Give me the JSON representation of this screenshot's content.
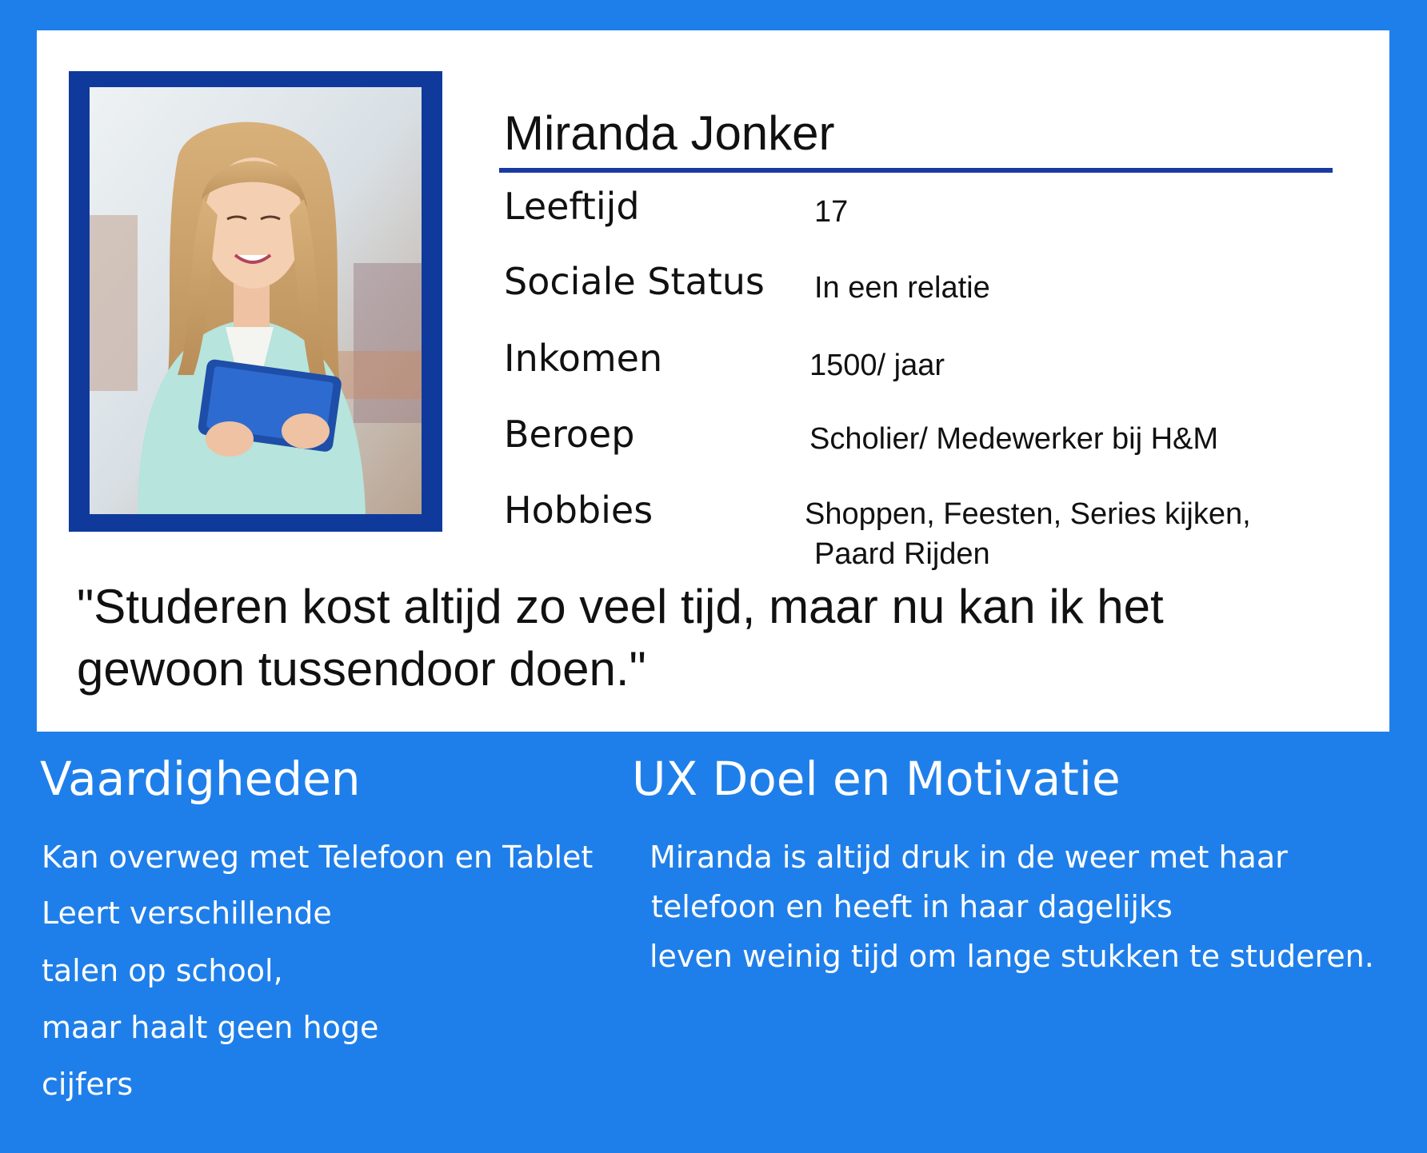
{
  "persona": {
    "name": "Miranda Jonker",
    "fields": [
      {
        "label": "Leeftijd",
        "value": "17"
      },
      {
        "label": "Sociale Status",
        "value": "In een relatie"
      },
      {
        "label": "Inkomen",
        "value": "1500/ jaar"
      },
      {
        "label": "Beroep",
        "value": "Scholier/ Medewerker bij H&M"
      },
      {
        "label": "Hobbies",
        "value": "Shoppen, Feesten, Series kijken,",
        "value2": "Paard Rijden"
      }
    ],
    "quote_line1": "\"Studeren kost altijd zo veel tijd, maar nu kan ik het",
    "quote_line2": "gewoon tussendoor doen.\""
  },
  "skills": {
    "title": "Vaardigheden",
    "lines": [
      "Kan overweg met Telefoon en Tablet",
      "Leert verschillende",
      "talen op school,",
      "maar haalt geen hoge",
      "cijfers"
    ]
  },
  "ux_goal": {
    "title": "UX Doel en Motivatie",
    "lines": [
      "Miranda is altijd druk in de weer met haar",
      "telefoon en heeft in haar dagelijks",
      "leven weinig tijd om lange stukken te studeren."
    ]
  },
  "colors": {
    "background": "#1f7fea",
    "card": "#ffffff",
    "frame": "#0f3a9c",
    "rule": "#1a3aa2"
  }
}
